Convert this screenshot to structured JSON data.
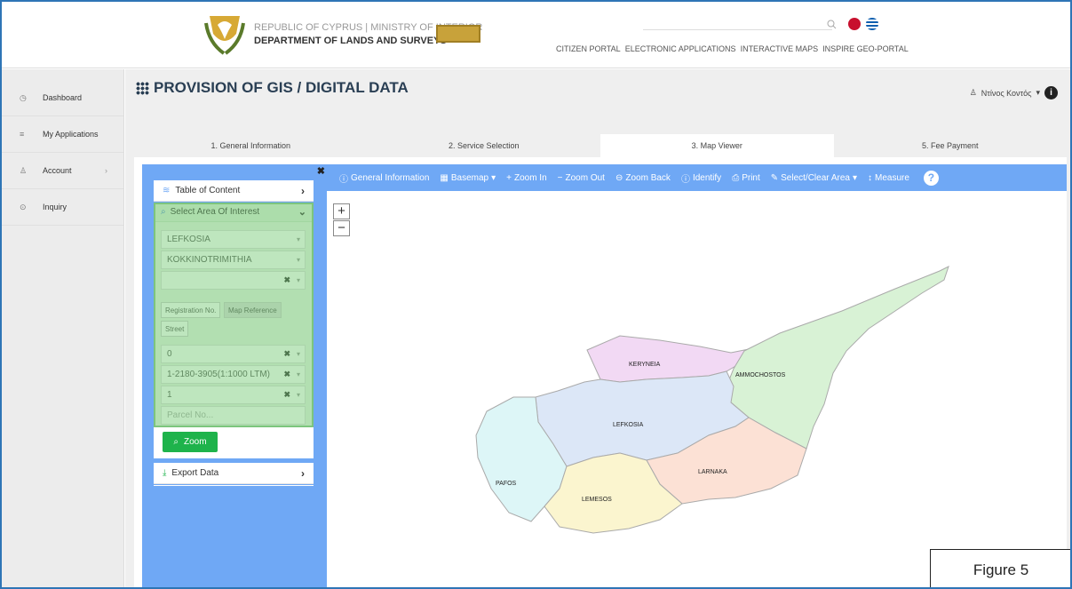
{
  "header": {
    "line1": "REPUBLIC OF CYPRUS | MINISTRY OF INTERIOR",
    "line2": "DEPARTMENT OF LANDS AND SURVEYS",
    "nav": [
      "CITIZEN PORTAL",
      "ELECTRONIC APPLICATIONS",
      "INTERACTIVE MAPS",
      "INSPIRE GEO-PORTAL"
    ]
  },
  "sidebar": {
    "items": [
      {
        "label": "Dashboard",
        "icon": "dashboard-icon"
      },
      {
        "label": "My Applications",
        "icon": "applications-icon"
      },
      {
        "label": "Account",
        "icon": "account-icon"
      },
      {
        "label": "Inquiry",
        "icon": "inquiry-icon"
      }
    ]
  },
  "page": {
    "title": "PROVISION OF GIS / DIGITAL DATA",
    "user": "Ντίνος Κοντός"
  },
  "tabs": [
    "1. General Information",
    "2. Service Selection",
    "3. Map Viewer",
    "5. Fee Payment"
  ],
  "panel": {
    "toc": "Table of Content",
    "aoi": "Select Area Of Interest",
    "district": "LEFKOSIA",
    "municipality": "KOKKINOTRIMITHIA",
    "subtabs": [
      "Registration No.",
      "Map Reference",
      "Street"
    ],
    "sheet": "0",
    "plan": "1-2180-3905(1:1000 LTM)",
    "block": "1",
    "parcel_placeholder": "Parcel No...",
    "zoom": "Zoom",
    "export": "Export Data"
  },
  "toolbar": [
    "General Information",
    "Basemap",
    "Zoom In",
    "Zoom Out",
    "Zoom Back",
    "Identify",
    "Print",
    "Select/Clear Area",
    "Measure"
  ],
  "map": {
    "regions": [
      "KERYNEIA",
      "AMMOCHOSTOS",
      "LEFKOSIA",
      "LARNAKA",
      "PAFOS",
      "LEMESOS"
    ]
  },
  "figure": "Figure 5"
}
